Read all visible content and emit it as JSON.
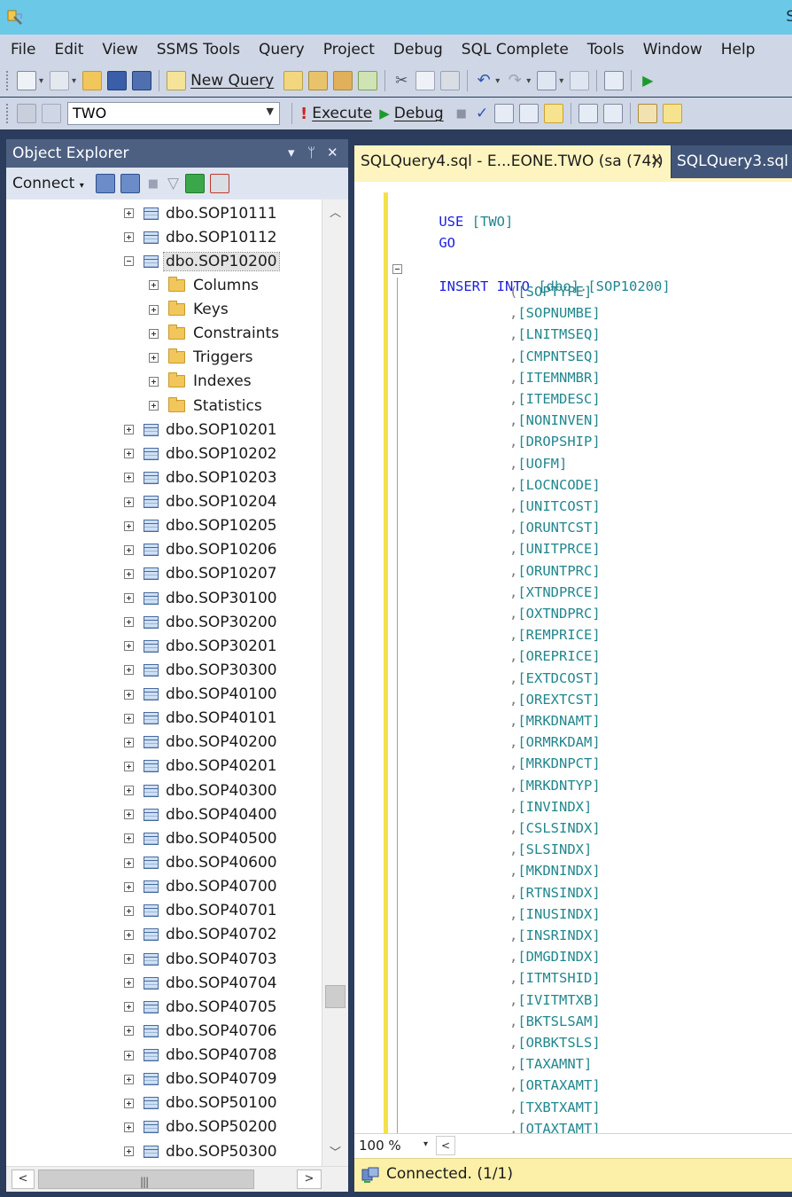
{
  "window": {
    "title_fragment": "S"
  },
  "menu": [
    "File",
    "Edit",
    "View",
    "SSMS Tools",
    "Query",
    "Project",
    "Debug",
    "SQL Complete",
    "Tools",
    "Window",
    "Help"
  ],
  "toolbar1": {
    "new_query_label": "New Query"
  },
  "toolbar2": {
    "database": "TWO",
    "execute_label": "Execute",
    "debug_label": "Debug"
  },
  "object_explorer": {
    "title": "Object Explorer",
    "pin_glyph": "▾ ⊥",
    "close_glyph": "✕",
    "connect_label": "Connect",
    "items": [
      {
        "label": "dbo.SOP10111",
        "type": "table",
        "expanded": false,
        "level": 0
      },
      {
        "label": "dbo.SOP10112",
        "type": "table",
        "expanded": false,
        "level": 0
      },
      {
        "label": "dbo.SOP10200",
        "type": "table",
        "expanded": true,
        "level": 0,
        "selected": true
      },
      {
        "label": "Columns",
        "type": "folder",
        "expanded": false,
        "level": 1
      },
      {
        "label": "Keys",
        "type": "folder",
        "expanded": false,
        "level": 1
      },
      {
        "label": "Constraints",
        "type": "folder",
        "expanded": false,
        "level": 1
      },
      {
        "label": "Triggers",
        "type": "folder",
        "expanded": false,
        "level": 1
      },
      {
        "label": "Indexes",
        "type": "folder",
        "expanded": false,
        "level": 1
      },
      {
        "label": "Statistics",
        "type": "folder",
        "expanded": false,
        "level": 1
      },
      {
        "label": "dbo.SOP10201",
        "type": "table",
        "expanded": false,
        "level": 0
      },
      {
        "label": "dbo.SOP10202",
        "type": "table",
        "expanded": false,
        "level": 0
      },
      {
        "label": "dbo.SOP10203",
        "type": "table",
        "expanded": false,
        "level": 0
      },
      {
        "label": "dbo.SOP10204",
        "type": "table",
        "expanded": false,
        "level": 0
      },
      {
        "label": "dbo.SOP10205",
        "type": "table",
        "expanded": false,
        "level": 0
      },
      {
        "label": "dbo.SOP10206",
        "type": "table",
        "expanded": false,
        "level": 0
      },
      {
        "label": "dbo.SOP10207",
        "type": "table",
        "expanded": false,
        "level": 0
      },
      {
        "label": "dbo.SOP30100",
        "type": "table",
        "expanded": false,
        "level": 0
      },
      {
        "label": "dbo.SOP30200",
        "type": "table",
        "expanded": false,
        "level": 0
      },
      {
        "label": "dbo.SOP30201",
        "type": "table",
        "expanded": false,
        "level": 0
      },
      {
        "label": "dbo.SOP30300",
        "type": "table",
        "expanded": false,
        "level": 0
      },
      {
        "label": "dbo.SOP40100",
        "type": "table",
        "expanded": false,
        "level": 0
      },
      {
        "label": "dbo.SOP40101",
        "type": "table",
        "expanded": false,
        "level": 0
      },
      {
        "label": "dbo.SOP40200",
        "type": "table",
        "expanded": false,
        "level": 0
      },
      {
        "label": "dbo.SOP40201",
        "type": "table",
        "expanded": false,
        "level": 0
      },
      {
        "label": "dbo.SOP40300",
        "type": "table",
        "expanded": false,
        "level": 0
      },
      {
        "label": "dbo.SOP40400",
        "type": "table",
        "expanded": false,
        "level": 0
      },
      {
        "label": "dbo.SOP40500",
        "type": "table",
        "expanded": false,
        "level": 0
      },
      {
        "label": "dbo.SOP40600",
        "type": "table",
        "expanded": false,
        "level": 0
      },
      {
        "label": "dbo.SOP40700",
        "type": "table",
        "expanded": false,
        "level": 0
      },
      {
        "label": "dbo.SOP40701",
        "type": "table",
        "expanded": false,
        "level": 0
      },
      {
        "label": "dbo.SOP40702",
        "type": "table",
        "expanded": false,
        "level": 0
      },
      {
        "label": "dbo.SOP40703",
        "type": "table",
        "expanded": false,
        "level": 0
      },
      {
        "label": "dbo.SOP40704",
        "type": "table",
        "expanded": false,
        "level": 0
      },
      {
        "label": "dbo.SOP40705",
        "type": "table",
        "expanded": false,
        "level": 0
      },
      {
        "label": "dbo.SOP40706",
        "type": "table",
        "expanded": false,
        "level": 0
      },
      {
        "label": "dbo.SOP40708",
        "type": "table",
        "expanded": false,
        "level": 0
      },
      {
        "label": "dbo.SOP40709",
        "type": "table",
        "expanded": false,
        "level": 0
      },
      {
        "label": "dbo.SOP50100",
        "type": "table",
        "expanded": false,
        "level": 0
      },
      {
        "label": "dbo.SOP50200",
        "type": "table",
        "expanded": false,
        "level": 0
      },
      {
        "label": "dbo.SOP50300",
        "type": "table",
        "expanded": false,
        "level": 0
      }
    ]
  },
  "tabs": [
    {
      "label": "SQLQuery4.sql - E...EONE.TWO (sa (74))",
      "active": true,
      "close_glyph": "✕"
    },
    {
      "label": "SQLQuery3.sql -",
      "active": false
    }
  ],
  "editor": {
    "use_kw": "USE",
    "use_db": "[TWO]",
    "go_kw": "GO",
    "insert_kw": "INSERT INTO",
    "insert_schema": "[dbo]",
    "insert_dot": ".",
    "insert_table": "[SOP10200]",
    "first_paren": "(",
    "separator": ",",
    "columns": [
      "[SOPTYPE]",
      "[SOPNUMBE]",
      "[LNITMSEQ]",
      "[CMPNTSEQ]",
      "[ITEMNMBR]",
      "[ITEMDESC]",
      "[NONINVEN]",
      "[DROPSHIP]",
      "[UOFM]",
      "[LOCNCODE]",
      "[UNITCOST]",
      "[ORUNTCST]",
      "[UNITPRCE]",
      "[ORUNTPRC]",
      "[XTNDPRCE]",
      "[OXTNDPRC]",
      "[REMPRICE]",
      "[OREPRICE]",
      "[EXTDCOST]",
      "[OREXTCST]",
      "[MRKDNAMT]",
      "[ORMRKDAM]",
      "[MRKDNPCT]",
      "[MRKDNTYP]",
      "[INVINDX]",
      "[CSLSINDX]",
      "[SLSINDX]",
      "[MKDNINDX]",
      "[RTNSINDX]",
      "[INUSINDX]",
      "[INSRINDX]",
      "[DMGDINDX]",
      "[ITMTSHID]",
      "[IVITMTXB]",
      "[BKTSLSAM]",
      "[ORBKTSLS]",
      "[TAXAMNT]",
      "[ORTAXAMT]",
      "[TXBTXAMT]",
      "[OTAXTAMT]"
    ]
  },
  "zoom": "100 %",
  "status": {
    "text": "Connected. (1/1)"
  },
  "colors": {
    "keyword": "#1f1fdc",
    "identifier": "#21878e",
    "tab_active": "#fdf4bf",
    "status_bar": "#fcf0a8",
    "title_bar": "#6bc8e6"
  }
}
